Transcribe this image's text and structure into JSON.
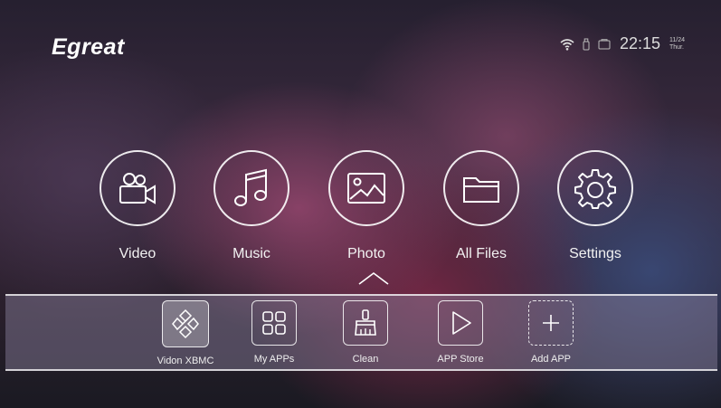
{
  "brand": {
    "logo": "Egreat"
  },
  "status": {
    "icons": [
      "wifi-icon",
      "usb-icon",
      "sd-card-icon"
    ],
    "time": "22:15",
    "date": "11/24",
    "weekday": "Thur."
  },
  "main_menu": {
    "items": [
      {
        "label": "Video",
        "icon": "video-camera-icon"
      },
      {
        "label": "Music",
        "icon": "music-note-icon"
      },
      {
        "label": "Photo",
        "icon": "photo-icon",
        "selected": true
      },
      {
        "label": "All Files",
        "icon": "folder-icon"
      },
      {
        "label": "Settings",
        "icon": "gear-icon"
      }
    ]
  },
  "dock": {
    "items": [
      {
        "label": "Vidon XBMC",
        "icon": "kodi-icon",
        "focused": true
      },
      {
        "label": "My APPs",
        "icon": "apps-grid-icon"
      },
      {
        "label": "Clean",
        "icon": "broom-icon"
      },
      {
        "label": "APP Store",
        "icon": "play-store-icon"
      },
      {
        "label": "Add APP",
        "icon": "plus-icon"
      }
    ]
  }
}
